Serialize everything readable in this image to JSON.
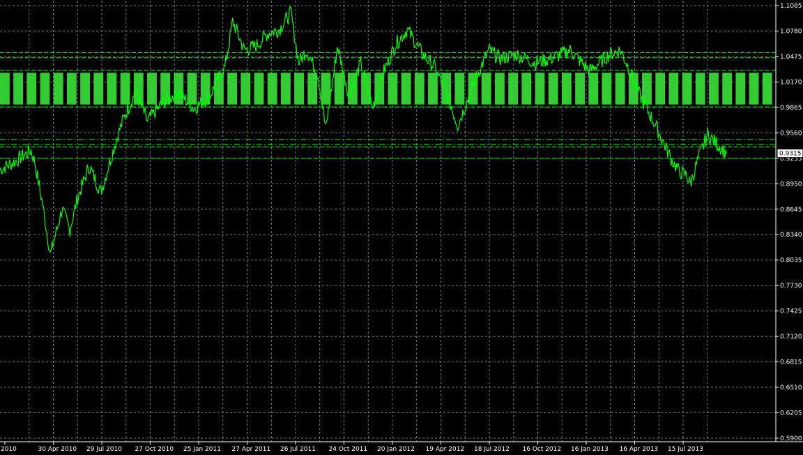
{
  "chart_data": {
    "type": "line",
    "colors": {
      "background": "#000000",
      "grid": "#6a7a88",
      "series": "#00ff00",
      "zone": "#33cc33",
      "axis_text": "#ffffff",
      "axis_line": "#ffffff"
    },
    "grid": true,
    "ylim": [
      0.59,
      1.1085
    ],
    "y_ticks": [
      "1.1085",
      "1.0780",
      "1.0475",
      "1.0170",
      "0.9865",
      "0.9560",
      "0.9255",
      "0.8950",
      "0.8645",
      "0.8340",
      "0.8035",
      "0.7730",
      "0.7425",
      "0.7120",
      "0.6815",
      "0.6510",
      "0.6205",
      "0.5900"
    ],
    "x_ticks": [
      "2010",
      "30 Apr 2010",
      "29 Jul 2010",
      "27 Oct 2010",
      "25 Jan 2011",
      "27 Apr 2011",
      "26 Jul 2011",
      "24 Oct 2011",
      "20 Jan 2012",
      "19 Apr 2012",
      "18 Jul 2012",
      "16 Oct 2012",
      "16 Jan 2013",
      "16 Apr 2013",
      "15 Jul 2013"
    ],
    "current_price": "0.9315",
    "series": [
      {
        "x": [
          0,
          0.02,
          0.04,
          0.045,
          0.055,
          0.065,
          0.08,
          0.09,
          0.1,
          0.115,
          0.13,
          0.15,
          0.16,
          0.175,
          0.19,
          0.21,
          0.23,
          0.25,
          0.27,
          0.29,
          0.3,
          0.315,
          0.33,
          0.345,
          0.36,
          0.375,
          0.385,
          0.395,
          0.41,
          0.42,
          0.435,
          0.45,
          0.465,
          0.48,
          0.495,
          0.51,
          0.525,
          0.545,
          0.56,
          0.575,
          0.59,
          0.615,
          0.63,
          0.645,
          0.665,
          0.69,
          0.71,
          0.735,
          0.76,
          0.785,
          0.8,
          0.81,
          0.825,
          0.845,
          0.865,
          0.875,
          0.885,
          0.89,
          0.9,
          0.912,
          0.9365
        ],
        "y": [
          0.912,
          0.922,
          0.935,
          0.92,
          0.87,
          0.81,
          0.865,
          0.84,
          0.878,
          0.916,
          0.885,
          0.948,
          0.975,
          1.005,
          0.97,
          0.992,
          1.005,
          0.985,
          1.0,
          1.035,
          1.09,
          1.055,
          1.06,
          1.075,
          1.08,
          1.1,
          1.04,
          1.055,
          1.025,
          0.96,
          1.06,
          1.0,
          1.04,
          0.985,
          1.03,
          1.062,
          1.08,
          1.05,
          1.035,
          1.005,
          0.965,
          1.025,
          1.055,
          1.045,
          1.05,
          1.04,
          1.045,
          1.055,
          1.03,
          1.05,
          1.055,
          1.035,
          1.0,
          0.965,
          0.925,
          0.91,
          0.905,
          0.895,
          0.925,
          0.954,
          0.9315
        ]
      }
    ],
    "zones": [
      {
        "from": 0.99,
        "to": 1.028,
        "style": "striped"
      }
    ],
    "hlines": [
      {
        "y": 1.052,
        "style": "dashed"
      },
      {
        "y": 1.046,
        "style": "dashed"
      },
      {
        "y": 1.031,
        "style": "dashed"
      },
      {
        "y": 0.987,
        "style": "dashed"
      },
      {
        "y": 0.948,
        "style": "dashdot"
      },
      {
        "y": 0.942,
        "style": "dashdot"
      },
      {
        "y": 0.939,
        "style": "dashed"
      },
      {
        "y": 0.9255,
        "style": "dashed"
      }
    ]
  }
}
